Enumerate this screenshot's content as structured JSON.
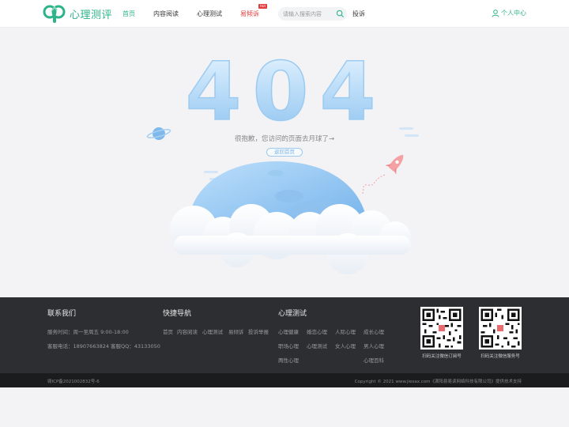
{
  "header": {
    "logo_text": "心理测评",
    "nav": [
      {
        "label": "首页",
        "active": true
      },
      {
        "label": "内容阅读"
      },
      {
        "label": "心理测试"
      },
      {
        "label": "易倾诉",
        "badge": "Hot"
      },
      {
        "label": "投诉"
      }
    ],
    "search_placeholder": "请输入搜索内容",
    "user_center": "个人中心"
  },
  "error": {
    "code": "404",
    "message": "很抱歉，您访问的页面去月球了→",
    "home_button": "返回首页"
  },
  "footer": {
    "contact": {
      "title": "联系我们",
      "hours": "服务时间：周一至周五 9:00-18:00",
      "phone": "客服电话：18907663824  客服QQ：43133050"
    },
    "quick_nav": {
      "title": "快捷导航",
      "links": [
        "首页",
        "内容阅读",
        "心理测试",
        "易倾诉",
        "投诉举报"
      ]
    },
    "tests": {
      "title": "心理测试",
      "links": [
        "心理健康",
        "婚恋心理",
        "人际心理",
        "成长心理",
        "职场心理",
        "心理测试",
        "女人心理",
        "男人心理",
        "两性心理",
        "心理百科"
      ]
    },
    "qr": [
      {
        "label": "扫码关注微信订阅号"
      },
      {
        "label": "扫码关注微信服务号"
      }
    ],
    "icp": "赣ICP备2021002832号-6",
    "copyright": "Copyright © 2021 www.jiesax.com《满阳县易读网络科技有限公司》提供技术支持"
  },
  "colors": {
    "brand": "#2db38a",
    "hot": "#e23b3b",
    "footer_bg": "#2c2e31",
    "error_blue": "#a8d3f5"
  }
}
